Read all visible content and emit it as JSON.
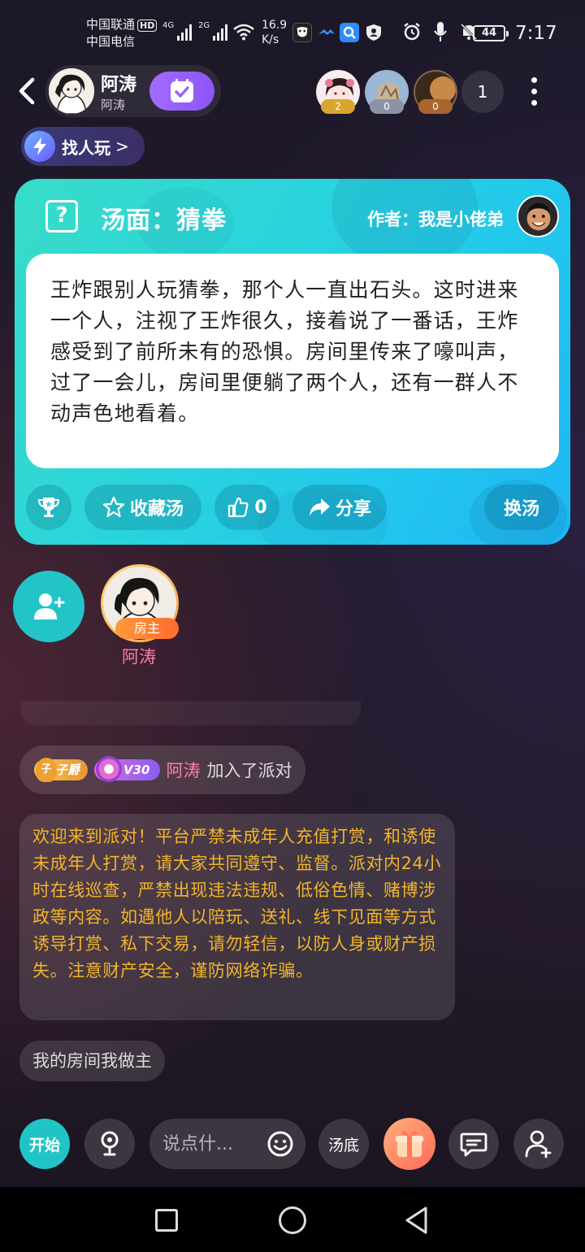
{
  "status_bar": {
    "carrier1": "中国联通",
    "carrier2": "中国电信",
    "hd_badge": "HD",
    "net1": "4G",
    "net2": "2G",
    "speed_value": "16.9",
    "speed_unit": "K/s",
    "battery": "44",
    "time": "7:17"
  },
  "header": {
    "host_name": "阿涛",
    "host_sub": "阿涛",
    "rank_badges": [
      "2",
      "0",
      "0"
    ],
    "online_count": "1"
  },
  "find_play": {
    "label": "找人玩",
    "chevron": ">"
  },
  "card": {
    "title": "汤面：猜拳",
    "author": "作者：我是小佬弟",
    "story": "王炸跟别人玩猜拳，那个人一直出石头。这时进来一个人，注视了王炸很久，接着说了一番话，王炸感受到了前所未有的恐惧。房间里传来了嚎叫声，过了一会儿，房间里便躺了两个人，还有一群人不动声色地看着。",
    "collect_label": "收藏汤",
    "like_count": "0",
    "share_label": "分享",
    "swap_label": "换汤"
  },
  "seats": {
    "host_tag": "房主",
    "host_name": "阿涛"
  },
  "messages": {
    "join": {
      "badge_title": "子爵",
      "badge_vip": "V30",
      "name": "阿涛",
      "text": "加入了派对"
    },
    "notice": "欢迎来到派对！平台严禁未成年人充值打赏，和诱使未成年人打赏，请大家共同遵守、监督。派对内24小时在线巡查，严禁出现违法违规、低俗色情、赌博涉政等内容。如遇他人以陪玩、送礼、线下见面等方式诱导打赏、私下交易，请勿轻信，以防人身或财产损失。注意财产安全，谨防网络诈骗。",
    "chip": "我的房间我做主"
  },
  "bottom_bar": {
    "start_label": "开始",
    "input_placeholder": "说点什...",
    "soup_label": "汤底"
  },
  "colors": {
    "card_gradient_start": "#38dcc8",
    "card_gradient_end": "#1eb6f4",
    "accent_teal": "#21c4c5",
    "name_pink": "#ff7fa6",
    "notice_yellow": "#f2b52a",
    "checkin_purple": "#9a63fb"
  }
}
